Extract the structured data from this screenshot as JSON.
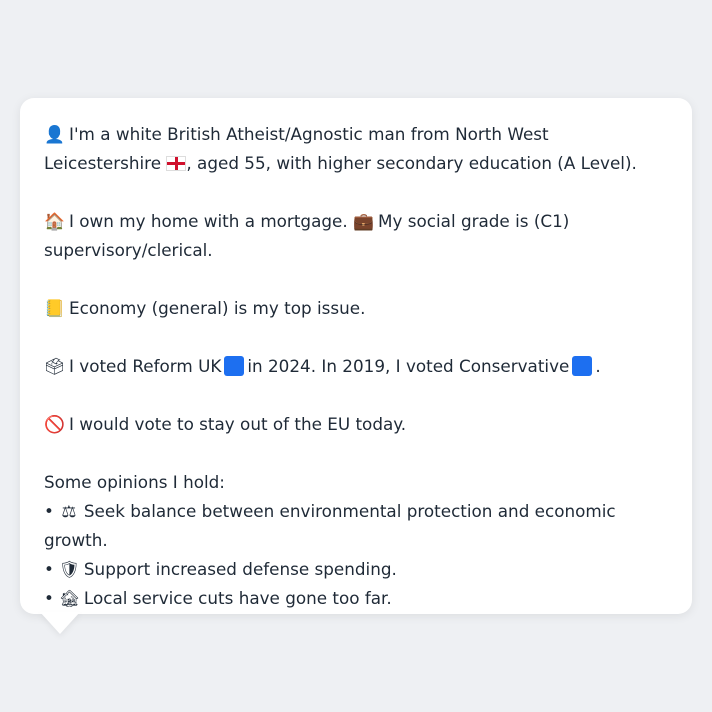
{
  "profile": {
    "intro_icon": "person-silhouette-icon",
    "intro_text_a": "I'm a white British Atheist/Agnostic man from North West Leicestershire",
    "intro_flag": "england-flag-icon",
    "intro_text_b": ", aged 55, with higher secondary education (A Level).",
    "home_icon": "house-icon",
    "home_text": "I own my home with a mortgage.",
    "grade_icon": "briefcase-icon",
    "grade_text": "My social grade is (C1) supervisory/clerical.",
    "issue_icon": "ledger-icon",
    "issue_text": "Economy (general) is my top issue.",
    "vote_icon": "ballot-box-icon",
    "vote_text_a": "I voted Reform UK",
    "vote_text_b": "in 2024. In 2019, I voted Conservative",
    "vote_text_c": ".",
    "eu_icon": "prohibited-icon",
    "eu_text": "I would vote to stay out of the EU today.",
    "opinions_heading": "Some opinions I hold:",
    "opinions": [
      {
        "icon": "balance-scale-icon",
        "text": "Seek balance between environmental protection and economic growth."
      },
      {
        "icon": "shield-icon",
        "text": "Support increased defense spending."
      },
      {
        "icon": "derelict-house-icon",
        "text": "Local service cuts have gone too far."
      }
    ],
    "bullet": "•"
  },
  "colors": {
    "background": "#eef0f3",
    "card": "#ffffff",
    "text": "#1f2a37",
    "party_square": "#1d6ff0"
  }
}
